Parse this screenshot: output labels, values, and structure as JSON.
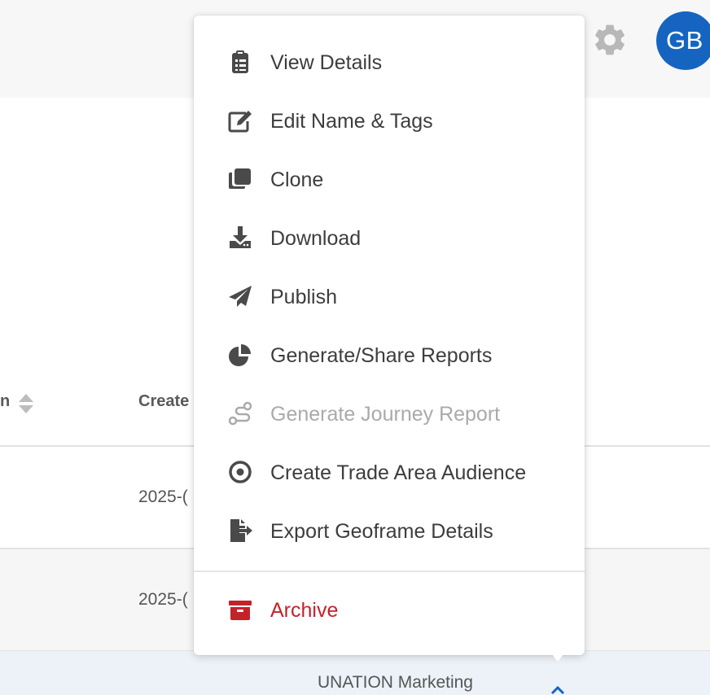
{
  "header": {
    "user_initials": "GB"
  },
  "table": {
    "headers": {
      "name_fragment": "n",
      "created_fragment": "Create"
    },
    "rows": [
      {
        "created_fragment": "2025-("
      },
      {
        "created_fragment": "2025-("
      },
      {
        "name_fragment": "UNATION Marketing"
      }
    ]
  },
  "menu": {
    "items": [
      {
        "label": "View Details",
        "icon": "clipboard-icon"
      },
      {
        "label": "Edit Name & Tags",
        "icon": "edit-icon"
      },
      {
        "label": "Clone",
        "icon": "clone-icon"
      },
      {
        "label": "Download",
        "icon": "download-icon"
      },
      {
        "label": "Publish",
        "icon": "paper-plane-icon"
      },
      {
        "label": "Generate/Share Reports",
        "icon": "pie-chart-icon"
      },
      {
        "label": "Generate Journey Report",
        "icon": "route-icon",
        "disabled": true
      },
      {
        "label": "Create Trade Area Audience",
        "icon": "target-icon"
      },
      {
        "label": "Export Geoframe Details",
        "icon": "file-export-icon"
      },
      {
        "label": "Archive",
        "icon": "archive-icon",
        "danger": true
      }
    ]
  },
  "colors": {
    "accent": "#1565c0",
    "danger": "#c4222b",
    "icon": "#4a4a4a",
    "disabled": "#aaaaaa"
  }
}
